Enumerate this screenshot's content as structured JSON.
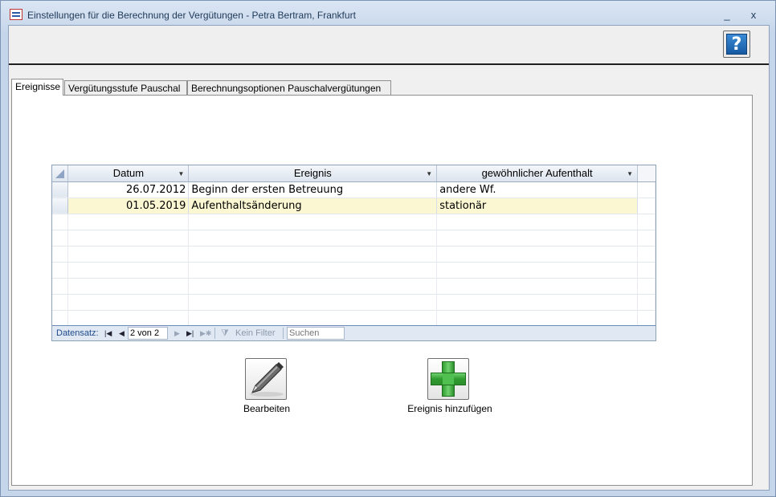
{
  "window": {
    "title": "Einstellungen für die Berechnung der Vergütungen - Petra Bertram, Frankfurt",
    "minimize_glyph": "_",
    "close_glyph": "x"
  },
  "help": {
    "glyph": "?",
    "icon": "help-icon"
  },
  "tabs": [
    {
      "label": "Ereignisse",
      "active": true
    },
    {
      "label": "Vergütungsstufe Pauschal",
      "active": false
    },
    {
      "label": "Berechnungsoptionen  Pauschalvergütungen",
      "active": false
    }
  ],
  "datasheet": {
    "columns": [
      "Datum",
      "Ereignis",
      "gewöhnlicher Aufenthalt"
    ],
    "rows": [
      {
        "datum": "26.07.2012",
        "ereignis": "Beginn der ersten Betreuung",
        "aufenthalt": "andere Wf.",
        "current": false
      },
      {
        "datum": "01.05.2019",
        "ereignis": "Aufenthaltsänderung",
        "aufenthalt": "stationär",
        "current": true
      }
    ]
  },
  "navigator": {
    "label": "Datensatz:",
    "position": "2 von 2",
    "filter_label": "Kein Filter",
    "search_placeholder": "Suchen"
  },
  "actions": {
    "edit_label": "Bearbeiten",
    "add_label": "Ereignis hinzufügen"
  }
}
